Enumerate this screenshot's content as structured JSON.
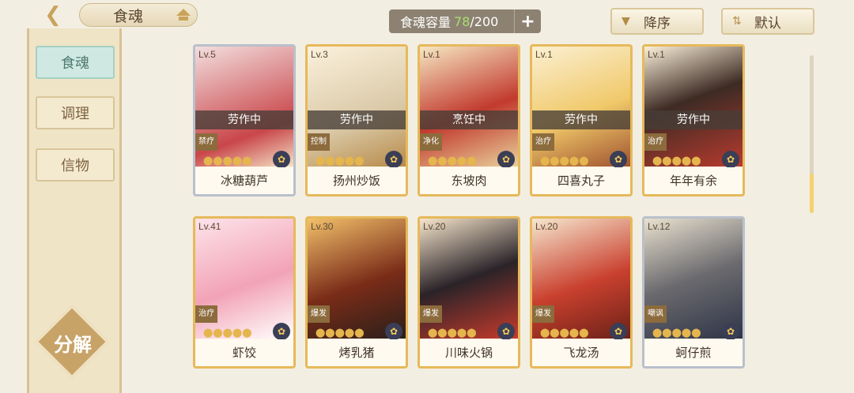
{
  "header": {
    "title": "食魂",
    "capacity_label": "食魂容量",
    "capacity_current": "78",
    "capacity_max": "/200",
    "capacity_add": "+",
    "sort_label": "降序",
    "default_label": "默认"
  },
  "sidebar": {
    "tabs": [
      {
        "label": "食魂",
        "active": true
      },
      {
        "label": "调理",
        "active": false
      },
      {
        "label": "信物",
        "active": false
      }
    ],
    "decompose_label": "分解"
  },
  "cards": [
    {
      "level": "Lv.5",
      "status": "劳作中",
      "role": "禁疗",
      "name": "冰糖葫芦",
      "frame": "silver",
      "stars": "⬤⬤⬤⬤⬤",
      "element": "✿"
    },
    {
      "level": "Lv.3",
      "status": "劳作中",
      "role": "控制",
      "name": "扬州炒饭",
      "frame": "gold",
      "stars": "⬤⬤⬤⬤⬤",
      "element": "✿"
    },
    {
      "level": "Lv.1",
      "status": "烹饪中",
      "role": "净化",
      "name": "东坡肉",
      "frame": "gold",
      "stars": "⬤⬤⬤⬤⬤",
      "element": "✿"
    },
    {
      "level": "Lv.1",
      "status": "劳作中",
      "role": "治疗",
      "name": "四喜丸子",
      "frame": "gold",
      "stars": "⬤⬤⬤⬤⬤",
      "element": "✿"
    },
    {
      "level": "Lv.1",
      "status": "劳作中",
      "role": "治疗",
      "name": "年年有余",
      "frame": "gold",
      "stars": "⬤⬤⬤⬤⬤",
      "element": "✿"
    },
    {
      "level": "Lv.41",
      "status": "",
      "role": "治疗",
      "name": "虾饺",
      "frame": "gold",
      "stars": "⬤⬤⬤⬤⬤",
      "element": "✿"
    },
    {
      "level": "Lv.30",
      "status": "",
      "role": "爆发",
      "name": "烤乳猪",
      "frame": "gold",
      "stars": "⬤⬤⬤⬤⬤",
      "element": "✿"
    },
    {
      "level": "Lv.20",
      "status": "",
      "role": "爆发",
      "name": "川味火锅",
      "frame": "gold",
      "stars": "⬤⬤⬤⬤⬤",
      "element": "✿"
    },
    {
      "level": "Lv.20",
      "status": "",
      "role": "爆发",
      "name": "飞龙汤",
      "frame": "gold",
      "stars": "⬤⬤⬤⬤⬤",
      "element": "✿"
    },
    {
      "level": "Lv.12",
      "status": "",
      "role": "嘲讽",
      "name": "蚵仔煎",
      "frame": "silver",
      "stars": "⬤⬤⬤⬤⬤",
      "element": "✿"
    }
  ],
  "colors": {
    "gold_frame": "#e6b95a",
    "silver_frame": "#b9c0cc",
    "active_tab": "#cfe9e2",
    "capacity_highlight": "#a7df6a"
  }
}
